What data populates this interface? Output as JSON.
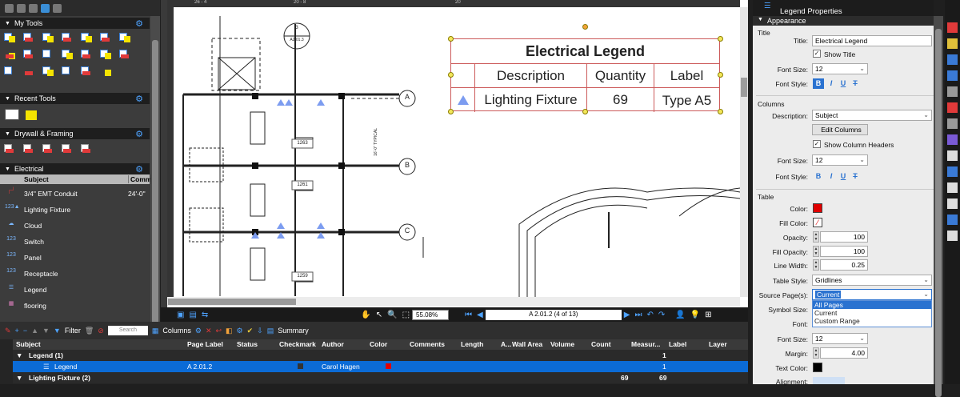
{
  "left_panel": {
    "sections": [
      "My Tools",
      "Recent Tools",
      "Drywall & Framing",
      "Electrical"
    ],
    "table_headers": [
      "Subject",
      "Comm"
    ],
    "electrical_items": [
      {
        "subject": "3/4\" EMT Conduit",
        "comment": "24'-0\""
      },
      {
        "subject": "Lighting Fixture",
        "comment": ""
      },
      {
        "subject": "Cloud",
        "comment": ""
      },
      {
        "subject": "Switch",
        "comment": ""
      },
      {
        "subject": "Panel",
        "comment": ""
      },
      {
        "subject": "Receptacle",
        "comment": ""
      },
      {
        "subject": "Legend",
        "comment": ""
      },
      {
        "subject": "flooring",
        "comment": ""
      }
    ]
  },
  "drawing": {
    "legend_title": "Electrical Legend",
    "legend_headers": [
      "Description",
      "Quantity",
      "Label"
    ],
    "legend_rows": [
      {
        "description": "Lighting Fixture",
        "quantity": "69",
        "label": "Type A5"
      }
    ],
    "grid_labels": [
      "A",
      "B",
      "C"
    ],
    "room_tags": [
      "1263",
      "1261",
      "1259"
    ],
    "section_tag": {
      "number": "3",
      "sheet": "A2.01.3"
    },
    "dimension_text": "16'-0\" TYPICAL",
    "ruler_marks": [
      "26 - 4",
      "20 - 8",
      "20"
    ]
  },
  "nav": {
    "zoom": "55.08%",
    "page": "A 2.01.2 (4 of 13)"
  },
  "markups_toolbar": {
    "filter_label": "Filter",
    "search_placeholder": "Search",
    "columns_label": "Columns",
    "summary_label": "Summary"
  },
  "markups_list": {
    "headers": [
      "Subject",
      "Page Label",
      "Status",
      "Checkmark",
      "Author",
      "Color",
      "Comments",
      "Length",
      "A...",
      "Wall Area",
      "Volume",
      "Count",
      "Measur...",
      "Label",
      "Layer"
    ],
    "rows": [
      {
        "subject": "Legend (1)",
        "type": "group",
        "count": "",
        "measure": "1"
      },
      {
        "subject": "Legend",
        "type": "item",
        "page": "A 2.01.2",
        "author": "Carol Hagen",
        "count": "",
        "measure": "1",
        "color": "#e00000"
      },
      {
        "subject": "Lighting Fixture (2)",
        "type": "group",
        "count": "69",
        "measure": "69"
      }
    ]
  },
  "properties": {
    "panel_title": "Legend Properties",
    "section": "Appearance",
    "title_group": "Title",
    "title_label": "Title:",
    "title_value": "Electrical Legend",
    "show_title": "Show Title",
    "font_size_label": "Font Size:",
    "font_size_value": "12",
    "font_style_label": "Font Style:",
    "columns_group": "Columns",
    "description_label": "Description:",
    "description_value": "Subject",
    "edit_columns": "Edit Columns",
    "show_column_headers": "Show Column Headers",
    "table_group": "Table",
    "color_label": "Color:",
    "fill_color_label": "Fill Color:",
    "opacity_label": "Opacity:",
    "opacity_value": "100",
    "fill_opacity_label": "Fill Opacity:",
    "fill_opacity_value": "100",
    "line_width_label": "Line Width:",
    "line_width_value": "0.25",
    "table_style_label": "Table Style:",
    "table_style_value": "Gridlines",
    "source_pages_label": "Source Page(s):",
    "source_pages_value": "Current",
    "source_options": [
      "All Pages",
      "Current",
      "Custom Range"
    ],
    "symbol_size_label": "Symbol Size:",
    "font_label": "Font:",
    "font_size2_label": "Font Size:",
    "font_size2_value": "12",
    "margin_label": "Margin:",
    "margin_value": "4.00",
    "text_color_label": "Text Color:",
    "alignment_label": "Alignment:",
    "table_color": "#e00000",
    "text_color": "#000000"
  }
}
